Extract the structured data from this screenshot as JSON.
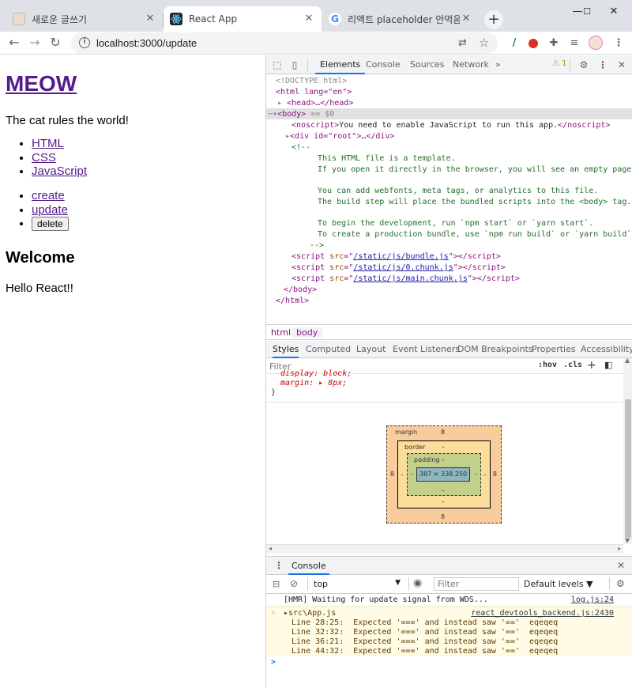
{
  "browser": {
    "tabs": [
      {
        "title": "새로운 글쓰기",
        "active": false
      },
      {
        "title": "React App",
        "active": true
      },
      {
        "title": "리액트 placeholder 안먹음 - Go",
        "active": false
      }
    ],
    "new_tab": "+",
    "window_controls": [
      "—",
      "☐",
      "✕"
    ],
    "url": "localhost:3000/update",
    "nav": {
      "back": "←",
      "forward": "→",
      "reload": "↻"
    },
    "toolbar_icons": [
      "translate-icon",
      "star-icon",
      "extension-icon",
      "extension-icon",
      "puzzle-icon",
      "playlist-icon",
      "avatar",
      "menu-icon"
    ]
  },
  "page": {
    "title": "MEOW",
    "description": "The cat rules the world!",
    "nav_links": [
      "HTML",
      "CSS",
      "JavaScript"
    ],
    "action_links": [
      "create",
      "update"
    ],
    "delete_button": "delete",
    "heading": "Welcome",
    "body_text": "Hello React!!"
  },
  "devtools": {
    "tabs": [
      "Elements",
      "Console",
      "Sources",
      "Network",
      "»"
    ],
    "active_tab": "Elements",
    "warning_count": "1",
    "dom": {
      "doctype": "<!DOCTYPE html>",
      "html_open": "<html lang=\"en\">",
      "head": "<head>…</head>",
      "body_open": "<body>",
      "body_sel": "== $0",
      "noscript_text": "You need to enable JavaScript to run this app.",
      "div_root": "<div id=\"root\">…</div>",
      "comment": [
        "<!--",
        "This HTML file is a template.",
        "If you open it directly in the browser, you will see an empty page.",
        "",
        "You can add webfonts, meta tags, or analytics to this file.",
        "The build step will place the bundled scripts into the <body> tag.",
        "",
        "To begin the development, run `npm start` or `yarn start`.",
        "To create a production bundle, use `npm run build` or `yarn build`.",
        "-->"
      ],
      "scripts": [
        "/static/js/bundle.js",
        "/static/js/0.chunk.js",
        "/static/js/main.chunk.js"
      ],
      "body_close": "</body>",
      "html_close": "</html>"
    },
    "breadcrumb": [
      "html",
      "body"
    ],
    "style_tabs": [
      "Styles",
      "Computed",
      "Layout",
      "Event Listeners",
      "DOM Breakpoints",
      "Properties",
      "Accessibility"
    ],
    "filter_placeholder": "Filter",
    "hov": ":hov",
    "cls": ".cls",
    "style_lines": [
      "display: block;",
      "margin: ▸ 8px;",
      "}"
    ],
    "box_model": {
      "margin_label": "margin",
      "margin": "8",
      "border_label": "border",
      "border": "–",
      "padding_label": "padding –",
      "padding": "–",
      "content": "387 × 338.250"
    },
    "drawer_tab": "Console",
    "console_toolbar": {
      "context": "top",
      "filter_placeholder": "Filter",
      "levels": "Default levels ▼"
    },
    "console_messages": [
      {
        "text": "[HMR] Waiting for update signal from WDS...",
        "source": "log.js:24",
        "type": "info"
      },
      {
        "text": "▸src\\App.js",
        "source": "react_devtools_backend.js:2430",
        "type": "warning",
        "lines": [
          "Line 28:25:  Expected '===' and instead saw '=='  eqeqeq",
          "Line 32:32:  Expected '===' and instead saw '=='  eqeqeq",
          "Line 36:21:  Expected '===' and instead saw '=='  eqeqeq",
          "Line 44:32:  Expected '===' and instead saw '=='  eqeqeq"
        ]
      }
    ],
    "prompt": ">"
  },
  "colors": {
    "tabstrip": "#dee1e6",
    "visited_link": "#551a8b",
    "devtools_accent": "#1a73e8",
    "warning_bg": "#fffbe5",
    "box_margin": "#f9cc9d",
    "box_border": "#fddd9b",
    "box_padding": "#c3d08b",
    "box_content": "#8cb6c0"
  }
}
